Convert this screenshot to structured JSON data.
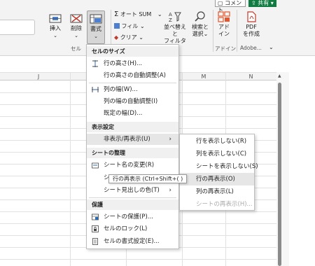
{
  "topbar": {
    "comment_label": "コメント",
    "share_label": "共有"
  },
  "ribbon": {
    "insert_label": "挿入",
    "delete_label": "削除",
    "format_label": "書式",
    "cells_group": "セル",
    "autosum_label": "オート SUM",
    "fill_label": "フィル",
    "clear_label": "クリア",
    "sort_filter_line1": "並べ替えと",
    "sort_filter_line2": "フィルター",
    "find_select_line1": "検索と",
    "find_select_line2": "選択",
    "addin_line1": "アド",
    "addin_line2": "イン",
    "addin_group": "アドイン",
    "pdf_line1": "PDF",
    "pdf_line2": "を作成",
    "adobe_group": "Adobe...",
    "accent": "#107c41"
  },
  "sheet": {
    "columns": [
      "J",
      "K",
      "L",
      "M",
      "N"
    ]
  },
  "format_menu": {
    "sections": [
      {
        "header": "セルのサイズ",
        "items": [
          {
            "label": "行の高さ(H)...",
            "icon": "row-height-icon"
          },
          {
            "label": "行の高さの自動調整(A)",
            "icon": ""
          },
          {
            "label": "列の幅(W)...",
            "icon": "column-width-icon"
          },
          {
            "label": "列の幅の自動調整(I)",
            "icon": ""
          },
          {
            "label": "既定の幅(D)...",
            "icon": ""
          }
        ]
      },
      {
        "header": "表示設定",
        "items": [
          {
            "label": "非表示/再表示(U)",
            "icon": "",
            "submenu": true
          }
        ]
      },
      {
        "header": "シートの整理",
        "items": [
          {
            "label": "シート名の変更(R)",
            "icon": "rename-sheet-icon"
          },
          {
            "label": "シ",
            "icon": ""
          },
          {
            "label": "シート見出しの色(T)",
            "icon": "",
            "submenu": true
          }
        ]
      },
      {
        "header": "保護",
        "items": [
          {
            "label": "シートの保護(P)...",
            "icon": "protect-sheet-icon"
          },
          {
            "label": "セルのロック(L)",
            "icon": "lock-icon"
          },
          {
            "label": "セルの書式設定(E)...",
            "icon": "format-cells-icon"
          }
        ]
      }
    ]
  },
  "hide_submenu": {
    "items": [
      {
        "label": "行を表示しない(R)",
        "enabled": true
      },
      {
        "label": "列を表示しない(C)",
        "enabled": true
      },
      {
        "label": "シートを表示しない(S)",
        "enabled": true
      },
      {
        "label": "行の再表示(O)",
        "enabled": true
      },
      {
        "label": "列の再表示(L)",
        "enabled": true
      },
      {
        "label": "シートの再表示(H)...",
        "enabled": false
      }
    ]
  },
  "tooltip": "行の再表示 (Ctrl+Shift+( )"
}
